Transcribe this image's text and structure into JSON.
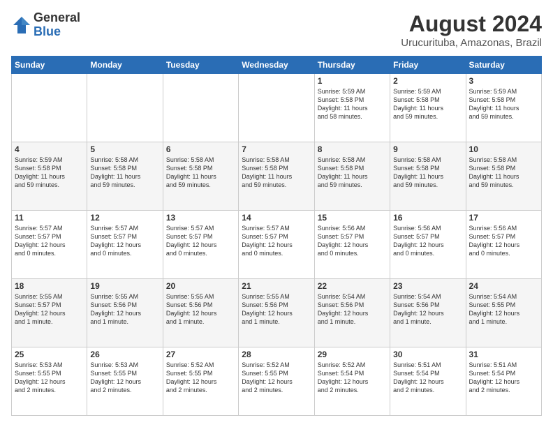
{
  "logo": {
    "general": "General",
    "blue": "Blue"
  },
  "title": {
    "month_year": "August 2024",
    "location": "Urucurituba, Amazonas, Brazil"
  },
  "weekdays": [
    "Sunday",
    "Monday",
    "Tuesday",
    "Wednesday",
    "Thursday",
    "Friday",
    "Saturday"
  ],
  "weeks": [
    [
      {
        "day": "",
        "info": ""
      },
      {
        "day": "",
        "info": ""
      },
      {
        "day": "",
        "info": ""
      },
      {
        "day": "",
        "info": ""
      },
      {
        "day": "1",
        "info": "Sunrise: 5:59 AM\nSunset: 5:58 PM\nDaylight: 11 hours\nand 58 minutes."
      },
      {
        "day": "2",
        "info": "Sunrise: 5:59 AM\nSunset: 5:58 PM\nDaylight: 11 hours\nand 59 minutes."
      },
      {
        "day": "3",
        "info": "Sunrise: 5:59 AM\nSunset: 5:58 PM\nDaylight: 11 hours\nand 59 minutes."
      }
    ],
    [
      {
        "day": "4",
        "info": "Sunrise: 5:59 AM\nSunset: 5:58 PM\nDaylight: 11 hours\nand 59 minutes."
      },
      {
        "day": "5",
        "info": "Sunrise: 5:58 AM\nSunset: 5:58 PM\nDaylight: 11 hours\nand 59 minutes."
      },
      {
        "day": "6",
        "info": "Sunrise: 5:58 AM\nSunset: 5:58 PM\nDaylight: 11 hours\nand 59 minutes."
      },
      {
        "day": "7",
        "info": "Sunrise: 5:58 AM\nSunset: 5:58 PM\nDaylight: 11 hours\nand 59 minutes."
      },
      {
        "day": "8",
        "info": "Sunrise: 5:58 AM\nSunset: 5:58 PM\nDaylight: 11 hours\nand 59 minutes."
      },
      {
        "day": "9",
        "info": "Sunrise: 5:58 AM\nSunset: 5:58 PM\nDaylight: 11 hours\nand 59 minutes."
      },
      {
        "day": "10",
        "info": "Sunrise: 5:58 AM\nSunset: 5:58 PM\nDaylight: 11 hours\nand 59 minutes."
      }
    ],
    [
      {
        "day": "11",
        "info": "Sunrise: 5:57 AM\nSunset: 5:57 PM\nDaylight: 12 hours\nand 0 minutes."
      },
      {
        "day": "12",
        "info": "Sunrise: 5:57 AM\nSunset: 5:57 PM\nDaylight: 12 hours\nand 0 minutes."
      },
      {
        "day": "13",
        "info": "Sunrise: 5:57 AM\nSunset: 5:57 PM\nDaylight: 12 hours\nand 0 minutes."
      },
      {
        "day": "14",
        "info": "Sunrise: 5:57 AM\nSunset: 5:57 PM\nDaylight: 12 hours\nand 0 minutes."
      },
      {
        "day": "15",
        "info": "Sunrise: 5:56 AM\nSunset: 5:57 PM\nDaylight: 12 hours\nand 0 minutes."
      },
      {
        "day": "16",
        "info": "Sunrise: 5:56 AM\nSunset: 5:57 PM\nDaylight: 12 hours\nand 0 minutes."
      },
      {
        "day": "17",
        "info": "Sunrise: 5:56 AM\nSunset: 5:57 PM\nDaylight: 12 hours\nand 0 minutes."
      }
    ],
    [
      {
        "day": "18",
        "info": "Sunrise: 5:55 AM\nSunset: 5:57 PM\nDaylight: 12 hours\nand 1 minute."
      },
      {
        "day": "19",
        "info": "Sunrise: 5:55 AM\nSunset: 5:56 PM\nDaylight: 12 hours\nand 1 minute."
      },
      {
        "day": "20",
        "info": "Sunrise: 5:55 AM\nSunset: 5:56 PM\nDaylight: 12 hours\nand 1 minute."
      },
      {
        "day": "21",
        "info": "Sunrise: 5:55 AM\nSunset: 5:56 PM\nDaylight: 12 hours\nand 1 minute."
      },
      {
        "day": "22",
        "info": "Sunrise: 5:54 AM\nSunset: 5:56 PM\nDaylight: 12 hours\nand 1 minute."
      },
      {
        "day": "23",
        "info": "Sunrise: 5:54 AM\nSunset: 5:56 PM\nDaylight: 12 hours\nand 1 minute."
      },
      {
        "day": "24",
        "info": "Sunrise: 5:54 AM\nSunset: 5:55 PM\nDaylight: 12 hours\nand 1 minute."
      }
    ],
    [
      {
        "day": "25",
        "info": "Sunrise: 5:53 AM\nSunset: 5:55 PM\nDaylight: 12 hours\nand 2 minutes."
      },
      {
        "day": "26",
        "info": "Sunrise: 5:53 AM\nSunset: 5:55 PM\nDaylight: 12 hours\nand 2 minutes."
      },
      {
        "day": "27",
        "info": "Sunrise: 5:52 AM\nSunset: 5:55 PM\nDaylight: 12 hours\nand 2 minutes."
      },
      {
        "day": "28",
        "info": "Sunrise: 5:52 AM\nSunset: 5:55 PM\nDaylight: 12 hours\nand 2 minutes."
      },
      {
        "day": "29",
        "info": "Sunrise: 5:52 AM\nSunset: 5:54 PM\nDaylight: 12 hours\nand 2 minutes."
      },
      {
        "day": "30",
        "info": "Sunrise: 5:51 AM\nSunset: 5:54 PM\nDaylight: 12 hours\nand 2 minutes."
      },
      {
        "day": "31",
        "info": "Sunrise: 5:51 AM\nSunset: 5:54 PM\nDaylight: 12 hours\nand 2 minutes."
      }
    ]
  ]
}
